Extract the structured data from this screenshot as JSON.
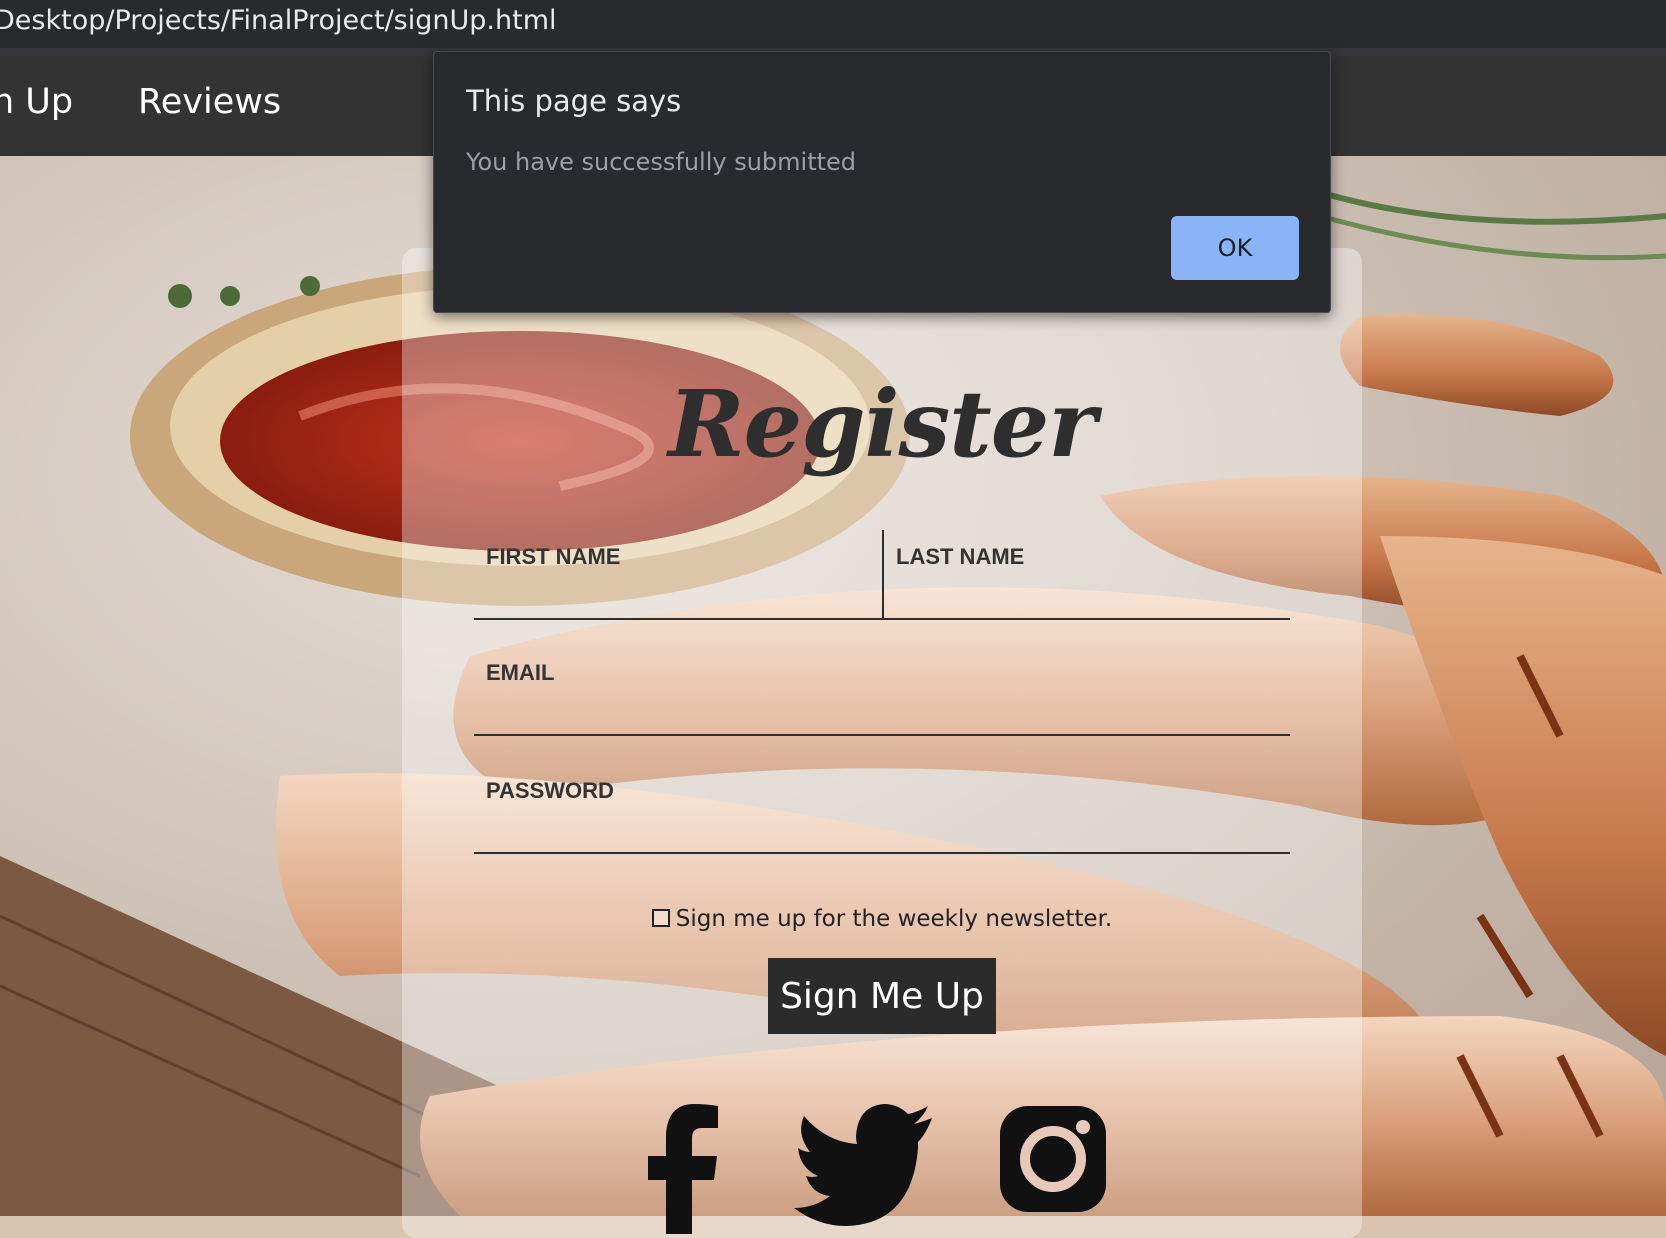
{
  "browser": {
    "url": "Desktop/Projects/FinalProject/signUp.html"
  },
  "nav": {
    "links": [
      {
        "label": "n Up"
      },
      {
        "label": "Reviews"
      }
    ]
  },
  "form": {
    "title": "Register",
    "first_name_label": "FIRST NAME",
    "last_name_label": "LAST NAME",
    "email_label": "EMAIL",
    "password_label": "PASSWORD",
    "newsletter_label": "Sign me up for the weekly newsletter.",
    "newsletter_checked": false,
    "submit_label": "Sign Me Up"
  },
  "social": {
    "icons": [
      "facebook-icon",
      "twitter-icon",
      "instagram-icon"
    ]
  },
  "dialog": {
    "title": "This page says",
    "message": "You have successfully submitted",
    "ok_label": "OK"
  },
  "colors": {
    "dialog_bg": "#292a2d",
    "ok_button": "#8ab4f8",
    "nav_bg": "#333333",
    "button_bg": "#2b2b2b"
  }
}
